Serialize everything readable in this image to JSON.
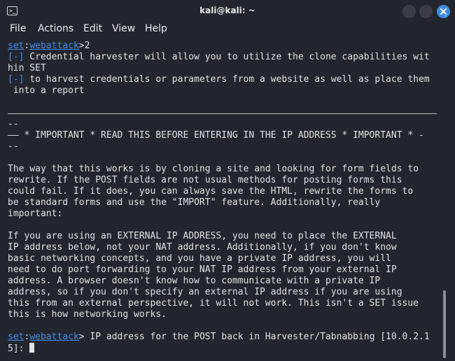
{
  "window": {
    "title": "kali@kali: ~"
  },
  "menu": [
    "File",
    "Actions",
    "Edit",
    "View",
    "Help"
  ],
  "terminal": {
    "prompt": {
      "set": "set",
      "sep": ":",
      "module": "webattack",
      "gt": ">"
    },
    "entered_choice": "2",
    "info_marker": "[-]",
    "info1a": " Credential harvester will allow you to utilize the clone capabilities wit",
    "info1b": "hin SET",
    "info2a": " to harvest credentials or parameters from a website as well as place them",
    "info2b": " into a report",
    "dash_short": "--",
    "important": "—— * IMPORTANT * READ THIS BEFORE ENTERING IN THE IP ADDRESS * IMPORTANT * -",
    "para1": [
      "The way that this works is by cloning a site and looking for form fields to",
      "rewrite. If the POST fields are not usual methods for posting forms this",
      "could fail. If it does, you can always save the HTML, rewrite the forms to",
      "be standard forms and use the \"IMPORT\" feature. Additionally, really",
      "important:"
    ],
    "para2": [
      "If you are using an EXTERNAL IP ADDRESS, you need to place the EXTERNAL",
      "IP address below, not your NAT address. Additionally, if you don't know",
      "basic networking concepts, and you have a private IP address, you will",
      "need to do port forwarding to your NAT IP address from your external IP",
      "address. A browser doesn't know how to communicate with a private IP",
      "address, so if you don't specify an external IP address if you are using",
      "this from an external perspective, it will not work. This isn't a SET issue",
      "this is how networking works."
    ],
    "question_a": " IP address for the POST back in Harvester/Tabnabbing [10.0.2.1",
    "question_b": "5]: "
  }
}
